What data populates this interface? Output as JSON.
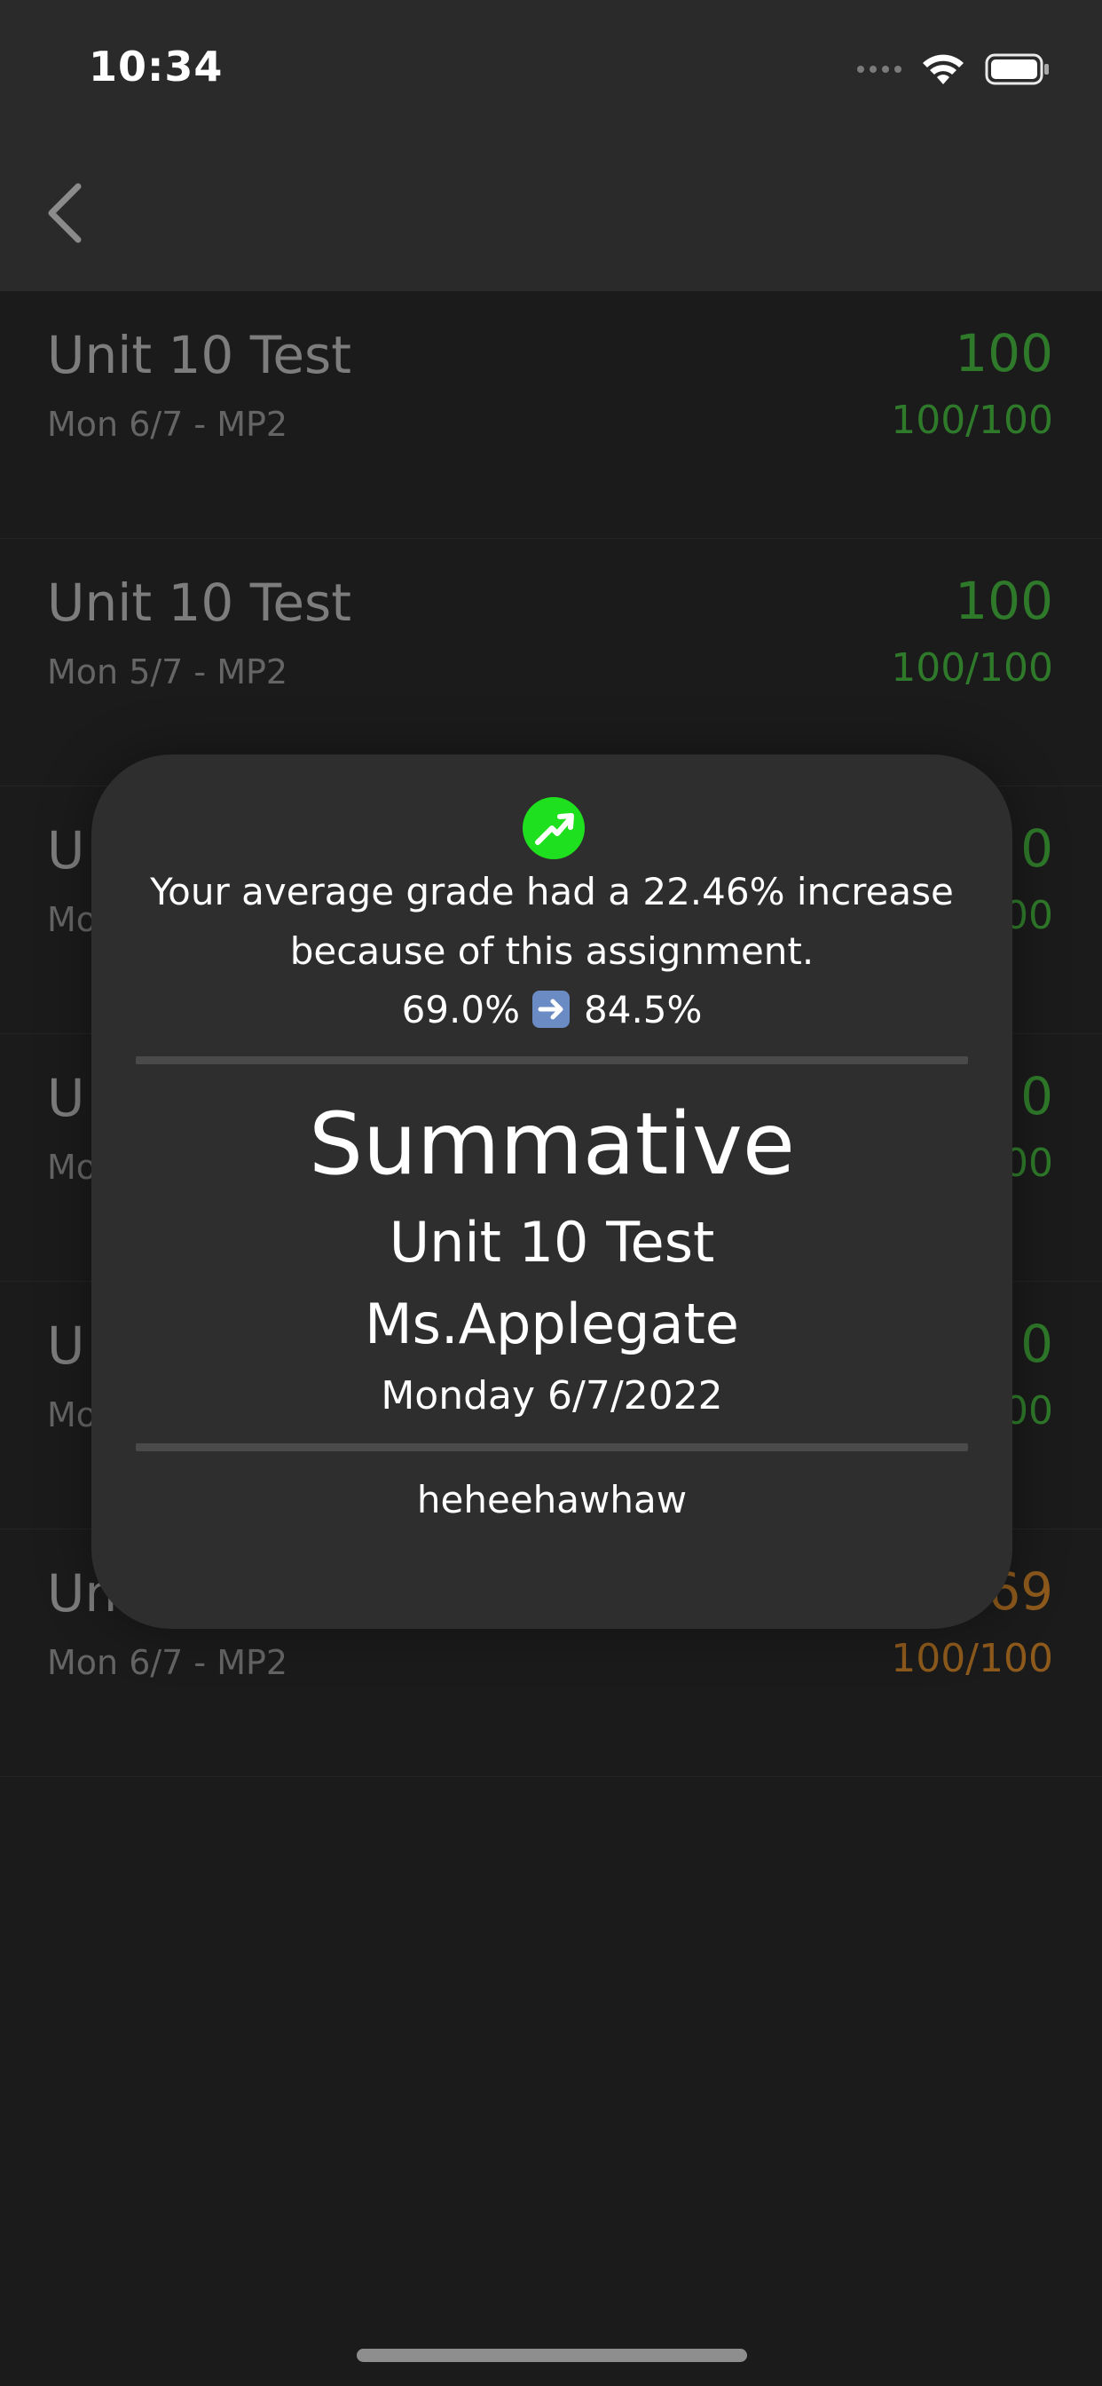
{
  "status_bar": {
    "time": "10:34"
  },
  "nav": {
    "back_icon": "chevron-left-icon"
  },
  "assignments": [
    {
      "title": "Unit 10 Test",
      "subtitle": "Mon 6/7 - MP2",
      "score": "100",
      "fraction": "100/100",
      "color": "green"
    },
    {
      "title": "Unit 10 Test",
      "subtitle": "Mon 5/7 - MP2",
      "score": "100",
      "fraction": "100/100",
      "color": "green"
    },
    {
      "title": "U",
      "subtitle": "Mo",
      "score": "0",
      "fraction": "00",
      "color": "green"
    },
    {
      "title": "U",
      "subtitle": "Mo",
      "score": "0",
      "fraction": "00",
      "color": "green"
    },
    {
      "title": "U",
      "subtitle": "Mo",
      "score": "0",
      "fraction": "00",
      "color": "green"
    },
    {
      "title": "Uni",
      "subtitle": "Mon 6/7 - MP2",
      "score": "69",
      "fraction": "100/100",
      "color": "orange"
    }
  ],
  "modal": {
    "trend_icon": "trending-up-icon",
    "message_line1": "Your average grade had a 22.46% increase",
    "message_line2": "because of this assignment.",
    "old_average": "69.0%",
    "arrow_icon": "arrow-right-emoji-icon",
    "new_average": "84.5%",
    "category": "Summative",
    "assignment_title": "Unit 10 Test",
    "teacher": "Ms.Applegate",
    "date": "Monday 6/7/2022",
    "comment": "heheehawhaw"
  },
  "colors": {
    "green": "#2f7a2a",
    "orange": "#8e5a1c",
    "trend_green": "#1ee01e"
  }
}
